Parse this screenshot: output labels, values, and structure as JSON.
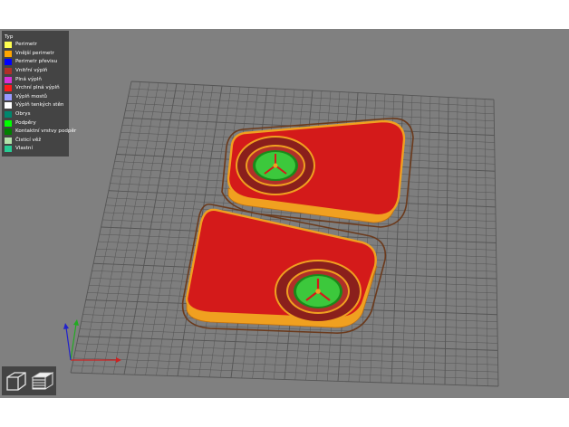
{
  "legend": {
    "title": "Typ",
    "items": [
      {
        "label": "Perimetr",
        "color": "#ffff50"
      },
      {
        "label": "Vnější perimetr",
        "color": "#ffa500"
      },
      {
        "label": "Perimetr převisu",
        "color": "#0000ff"
      },
      {
        "label": "Vnitřní výplň",
        "color": "#b03029"
      },
      {
        "label": "Plná výplň",
        "color": "#d732d7"
      },
      {
        "label": "Vrchní plná výplň",
        "color": "#ff1a1a"
      },
      {
        "label": "Výplň mostů",
        "color": "#9999ff"
      },
      {
        "label": "Výplň tenkých stěn",
        "color": "#ffffff"
      },
      {
        "label": "Obrys",
        "color": "#00876e"
      },
      {
        "label": "Podpěry",
        "color": "#00ff00"
      },
      {
        "label": "Kontaktní vrstvy podpěr",
        "color": "#008000"
      },
      {
        "label": "Čisticí věž",
        "color": "#b3e3ab"
      },
      {
        "label": "Vlastní",
        "color": "#28cc94"
      }
    ]
  },
  "colors": {
    "bed_background": "#808080",
    "grid_line": "#555555",
    "skirt": "#6b3a1c",
    "top_fill": "#d41a1a",
    "outer_perimeter": "#f0a020",
    "support": "#3cc83c",
    "support_interface": "#1a8a1a",
    "axis_x": "#cc2222",
    "axis_y": "#22aa22",
    "axis_z": "#2222cc"
  },
  "icons": {
    "view_3d": "cube-icon",
    "view_layers": "layers-icon"
  }
}
